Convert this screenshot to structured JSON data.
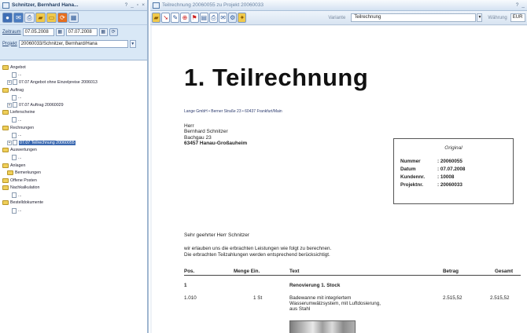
{
  "left_window": {
    "title": "Schnitzer, Bernhard Hana...",
    "title_controls": [
      "?",
      "_",
      "▫",
      "×"
    ],
    "filter": {
      "zeitraum_label": "Zeitraum",
      "date_from": "07.05.2008",
      "date_to": "07.07.2008",
      "projekt_label": "Projekt",
      "projekt_value": "20060033/Schnitzer, Bernhard/Hana"
    },
    "tree": [
      {
        "type": "folder",
        "indent": 0,
        "label": "Angebot"
      },
      {
        "type": "doc",
        "indent": 2,
        "label": "..."
      },
      {
        "type": "entry",
        "indent": 1,
        "label": "07.07 Angebot ohne Einzelpreise 2006013"
      },
      {
        "type": "folder",
        "indent": 0,
        "label": "Auftrag"
      },
      {
        "type": "doc",
        "indent": 2,
        "label": "..."
      },
      {
        "type": "entry",
        "indent": 1,
        "label": "07.07 Auftrag 20060029"
      },
      {
        "type": "folder",
        "indent": 0,
        "label": "Lieferscheine"
      },
      {
        "type": "doc",
        "indent": 2,
        "label": "..."
      },
      {
        "type": "folder",
        "indent": 0,
        "label": "Rechnungen"
      },
      {
        "type": "doc",
        "indent": 2,
        "label": "..."
      },
      {
        "type": "entry",
        "indent": 1,
        "label": "07.07 Teilrechnung 20060055",
        "selected": true
      },
      {
        "type": "folder",
        "indent": 0,
        "label": "Auswertungen"
      },
      {
        "type": "doc",
        "indent": 2,
        "label": "..."
      },
      {
        "type": "folder",
        "indent": 0,
        "label": "Anlagen"
      },
      {
        "type": "folder",
        "indent": 1,
        "label": "Bemerkungen"
      },
      {
        "type": "folder",
        "indent": 0,
        "label": "Offene Posten"
      },
      {
        "type": "folder",
        "indent": 0,
        "label": "Nachkalkulation"
      },
      {
        "type": "doc",
        "indent": 2,
        "label": "..."
      },
      {
        "type": "folder",
        "indent": 0,
        "label": "Bestelldokumente"
      },
      {
        "type": "doc",
        "indent": 2,
        "label": "..."
      }
    ]
  },
  "right_window": {
    "title": "Teilrechnung 20060055 zu Projekt 20060033",
    "title_controls": [
      "?",
      "_"
    ],
    "variante_label": "Variante",
    "variante_value": "Teilrechnung",
    "waehrung_label": "Währung",
    "waehrung_value": "EUR"
  },
  "document": {
    "heading": "1. Teilrechnung",
    "sender_line": "Lange GmbH • Berner Straße 23 • 60437 Frankfurt/Main",
    "recipient": {
      "line1": "Herr",
      "line2": "Bernhard Schnitzer",
      "line3": "Bachgau 23",
      "line4": "63457 Hanau-Großauheim"
    },
    "infobox": {
      "label": "Original",
      "nummer_label": "Nummer",
      "nummer_value": ": 20060055",
      "datum_label": "Datum",
      "datum_value": ": 07.07.2008",
      "kundennr_label": "Kundennr.",
      "kundennr_value": ": 10008",
      "projektnr_label": "Projektnr.",
      "projektnr_value": ": 20060033"
    },
    "greeting": "Sehr geehrter Herr Schnitzer",
    "intro_line1": "wir erlauben uns die erbrachten Leistungen wie folgt zu berechnen.",
    "intro_line2": "Die erbrachten Teilzahlungen werden entsprechend berücksichtigt.",
    "table_headers": {
      "pos": "Pos.",
      "menge": "Menge Ein.",
      "text": "Text",
      "betrag": "Betrag",
      "gesamt": "Gesamt"
    },
    "group": {
      "pos": "1",
      "text": "Renovierung 1. Stock"
    },
    "item": {
      "pos": "1.010",
      "menge": "1 St",
      "text_line1": "Badewanne mit integriertem",
      "text_line2": "Wasserumwälzsystem, mit Luftdosierung,",
      "text_line3": "aus Stahl",
      "betrag": "2.515,52",
      "gesamt": "2.515,52"
    }
  }
}
